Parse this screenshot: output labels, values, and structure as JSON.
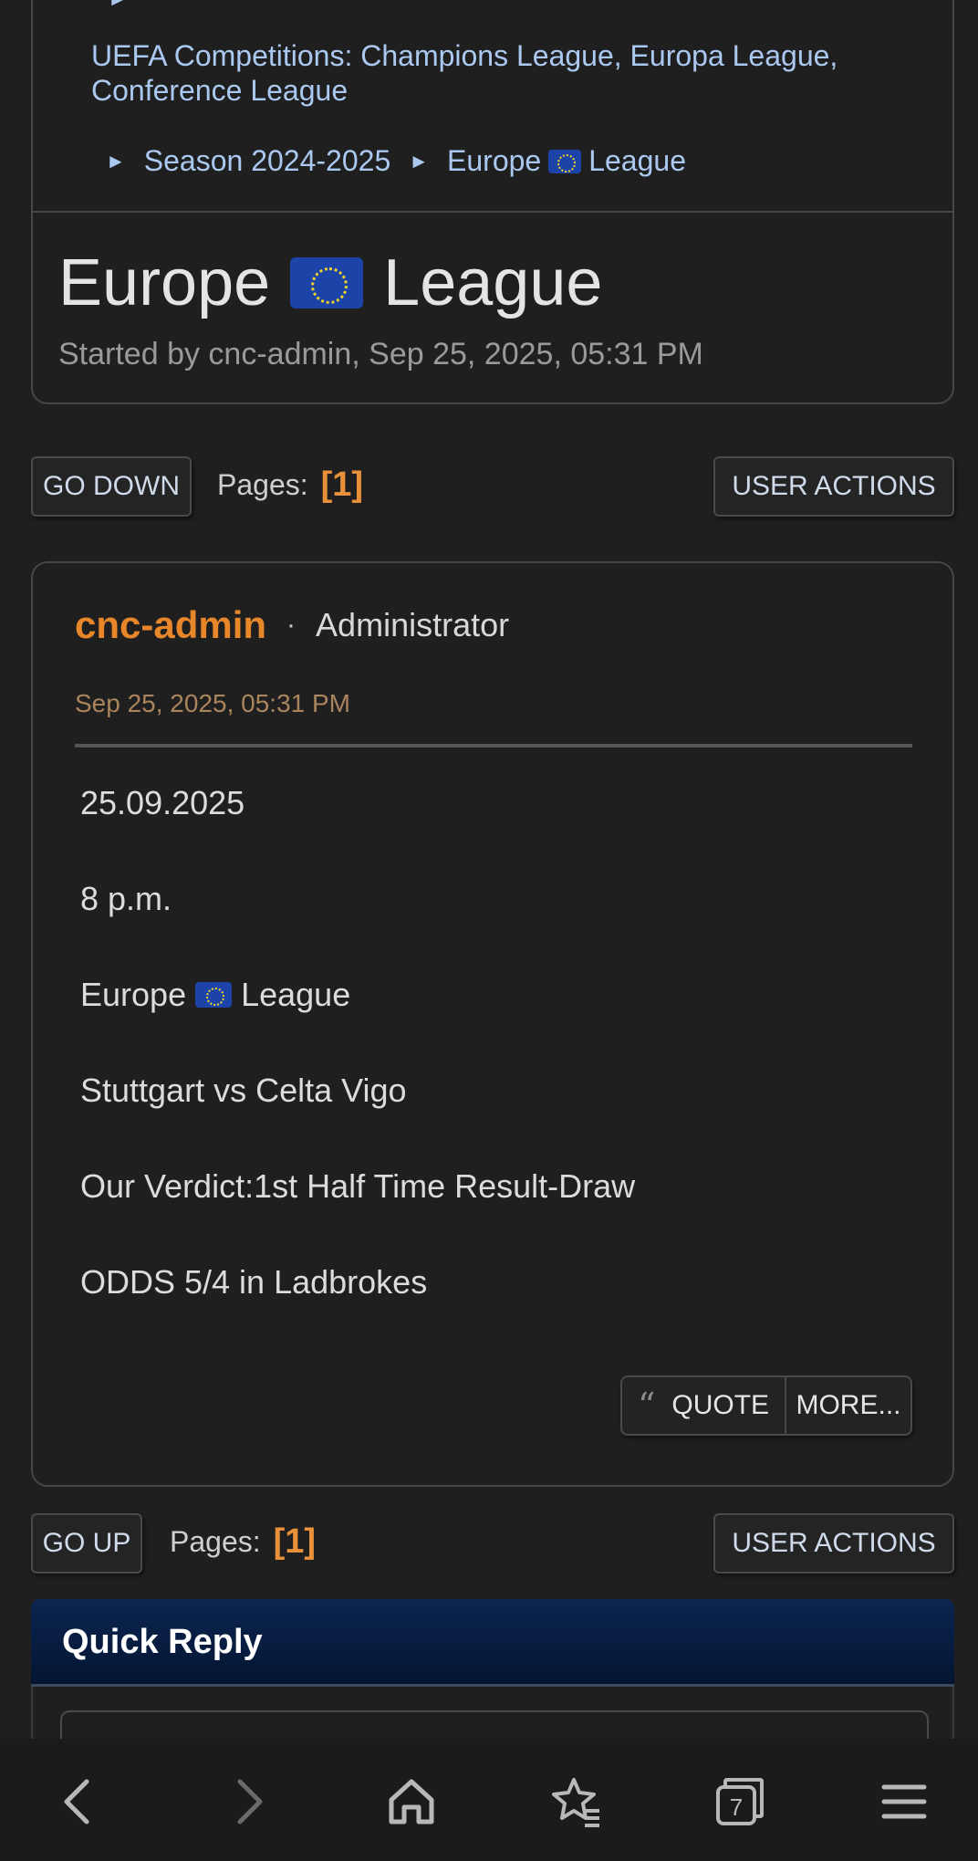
{
  "breadcrumb": {
    "top_arrow": "►",
    "parent": "UEFA Competitions: Champions League, Europa League, Conference League",
    "separator": "►",
    "items": [
      {
        "label": "Season 2024-2025"
      },
      {
        "label_before_flag": "Europe",
        "label_after_flag": "League"
      }
    ]
  },
  "topic": {
    "title_before_flag": "Europe",
    "title_after_flag": "League",
    "meta": "Started by cnc-admin, Sep 25, 2025, 05:31 PM"
  },
  "top_bar": {
    "go_button": "GO DOWN",
    "pages_label": "Pages:",
    "pages_value": "[1]",
    "user_actions": "USER ACTIONS"
  },
  "post": {
    "author": "cnc-admin",
    "separator": "·",
    "role": "Administrator",
    "date": "Sep 25, 2025, 05:31 PM",
    "lines": [
      {
        "text": "25.09.2025"
      },
      {
        "text": "8 p.m."
      },
      {
        "before_flag": "Europe",
        "after_flag": "League"
      },
      {
        "text": "Stuttgart vs Celta Vigo"
      },
      {
        "text": "Our Verdict:1st Half Time Result-Draw"
      },
      {
        "text": "ODDS 5/4 in Ladbrokes"
      }
    ],
    "quote_glyph": "“",
    "quote_label": "QUOTE",
    "more_label": "MORE..."
  },
  "bottom_bar": {
    "go_button": "GO UP",
    "pages_label": "Pages:",
    "pages_value": "[1]",
    "user_actions": "USER ACTIONS"
  },
  "quick_reply": {
    "title": "Quick Reply"
  },
  "toolbar": {
    "tab_count": "7",
    "icons": [
      "back-icon",
      "forward-icon",
      "home-icon",
      "bookmarks-icon",
      "tabs-icon",
      "menu-icon"
    ]
  },
  "colors": {
    "background": "#1f1f1f",
    "accent_orange": "#e8862a",
    "link_blue": "#aac8f0",
    "quick_reply_header": "#0c2550"
  }
}
